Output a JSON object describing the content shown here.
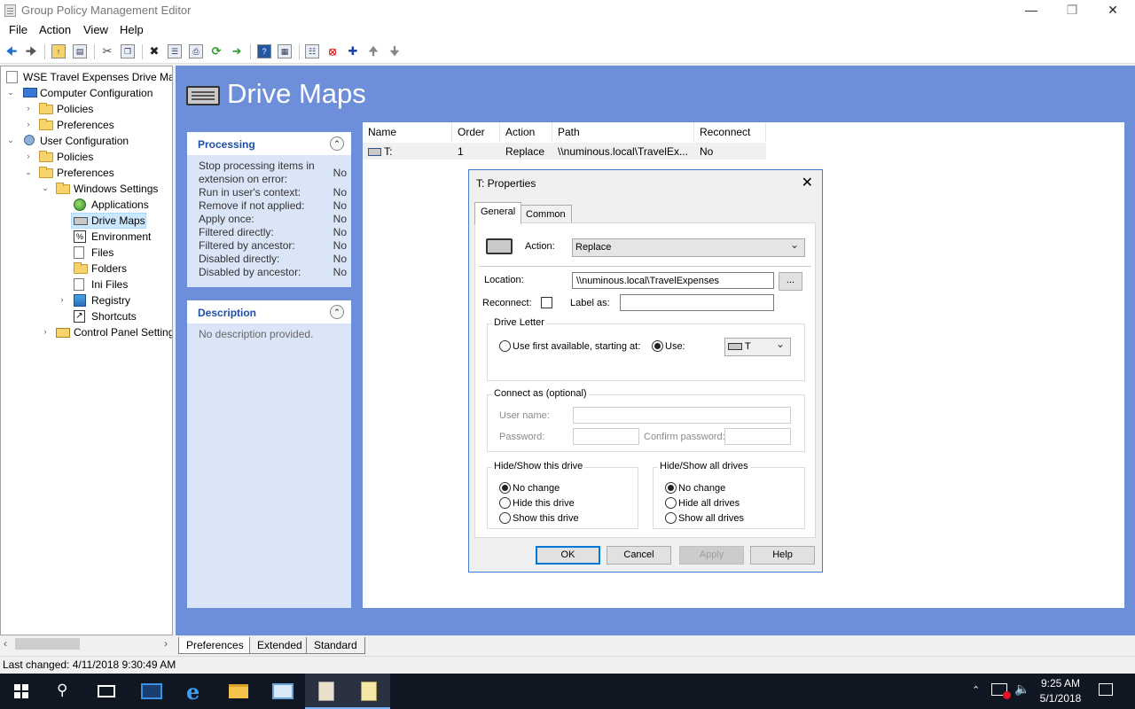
{
  "window": {
    "title": "Group Policy Management Editor",
    "minimize_icon": "minimize-icon",
    "maximize_icon": "restore-icon",
    "close_icon": "close-icon"
  },
  "menu": [
    "File",
    "Action",
    "View",
    "Help"
  ],
  "tree": {
    "root": "WSE Travel Expenses Drive Mapping",
    "computer_config": "Computer Configuration",
    "policies_1": "Policies",
    "preferences_1": "Preferences",
    "user_config": "User Configuration",
    "policies_2": "Policies",
    "preferences_2": "Preferences",
    "windows_settings": "Windows Settings",
    "applications": "Applications",
    "drive_maps": "Drive Maps",
    "environment": "Environment",
    "files": "Files",
    "folders": "Folders",
    "ini_files": "Ini Files",
    "registry": "Registry",
    "shortcuts": "Shortcuts",
    "control_panel": "Control Panel Settings"
  },
  "header": {
    "title": "Drive Maps"
  },
  "processing": {
    "title": "Processing",
    "rows": [
      {
        "label": "Stop processing items in",
        "label2": "extension on error:",
        "value": "No"
      },
      {
        "label": "Run in user's context:",
        "value": "No"
      },
      {
        "label": "Remove if not applied:",
        "value": "No"
      },
      {
        "label": "Apply once:",
        "value": "No"
      },
      {
        "label": "Filtered directly:",
        "value": "No"
      },
      {
        "label": "Filtered by ancestor:",
        "value": "No"
      },
      {
        "label": "Disabled directly:",
        "value": "No"
      },
      {
        "label": "Disabled by ancestor:",
        "value": "No"
      }
    ]
  },
  "description": {
    "title": "Description",
    "text": "No description provided."
  },
  "list": {
    "columns": [
      "Name",
      "Order",
      "Action",
      "Path",
      "Reconnect"
    ],
    "rows": [
      {
        "name": "T:",
        "order": "1",
        "action": "Replace",
        "path": "\\\\numinous.local\\TravelEx...",
        "reconnect": "No"
      }
    ]
  },
  "bottom_tabs": [
    "Preferences",
    "Extended",
    "Standard"
  ],
  "status": "Last changed: 4/11/2018 9:30:49 AM",
  "dialog": {
    "title": "T: Properties",
    "tabs": [
      "General",
      "Common"
    ],
    "action_label": "Action:",
    "action_value": "Replace",
    "location_label": "Location:",
    "location_value": "\\\\numinous.local\\TravelExpenses",
    "browse_label": "...",
    "reconnect_label": "Reconnect:",
    "label_as_label": "Label as:",
    "drive_letter_title": "Drive Letter",
    "use_first_label": "Use first available, starting at:",
    "use_label": "Use:",
    "drive_value": "T",
    "connect_as_title": "Connect as (optional)",
    "username_label": "User name:",
    "password_label": "Password:",
    "confirm_password_label": "Confirm password:",
    "hide_show_drive_title": "Hide/Show this drive",
    "hide_show_drive_options": [
      "No change",
      "Hide this drive",
      "Show this drive"
    ],
    "hide_show_all_title": "Hide/Show all drives",
    "hide_show_all_options": [
      "No change",
      "Hide all drives",
      "Show all drives"
    ],
    "buttons": {
      "ok": "OK",
      "cancel": "Cancel",
      "apply": "Apply",
      "help": "Help"
    }
  },
  "taskbar": {
    "time": "9:25 AM",
    "date": "5/1/2018"
  }
}
